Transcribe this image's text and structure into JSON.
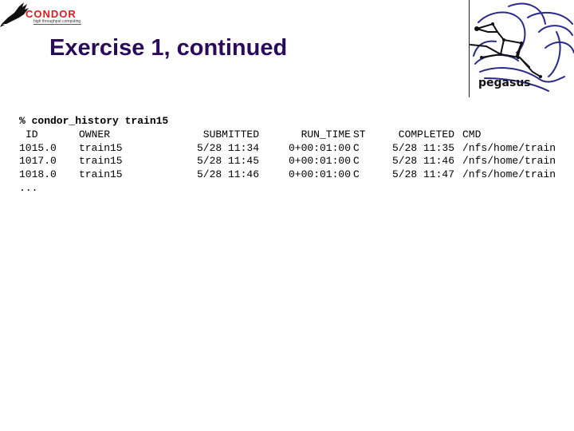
{
  "header": {
    "condor_logo": {
      "name": "CONDOR",
      "tagline": "high throughput computing",
      "color": "#d42020"
    },
    "title": "Exercise 1, continued",
    "title_color": "#2a0a5a",
    "pegasus_logo": {
      "name": "pegasus"
    }
  },
  "terminal": {
    "command": "% condor_history train15",
    "columns": {
      "id": "ID",
      "owner": "OWNER",
      "submitted": "SUBMITTED",
      "run_time": "RUN_TIME",
      "st": "ST",
      "completed": "COMPLETED",
      "cmd": "CMD"
    },
    "rows": [
      {
        "id": "1015.0",
        "owner": "train15",
        "submitted": "5/28 11:34",
        "run_time": "0+00:01:00",
        "st": "C",
        "completed": "5/28 11:35",
        "cmd": "/nfs/home/train"
      },
      {
        "id": "1017.0",
        "owner": "train15",
        "submitted": "5/28 11:45",
        "run_time": "0+00:01:00",
        "st": "C",
        "completed": "5/28 11:46",
        "cmd": "/nfs/home/train"
      },
      {
        "id": "1018.0",
        "owner": "train15",
        "submitted": "5/28 11:46",
        "run_time": "0+00:01:00",
        "st": "C",
        "completed": "5/28 11:47",
        "cmd": "/nfs/home/train"
      }
    ],
    "ellipsis": "..."
  }
}
